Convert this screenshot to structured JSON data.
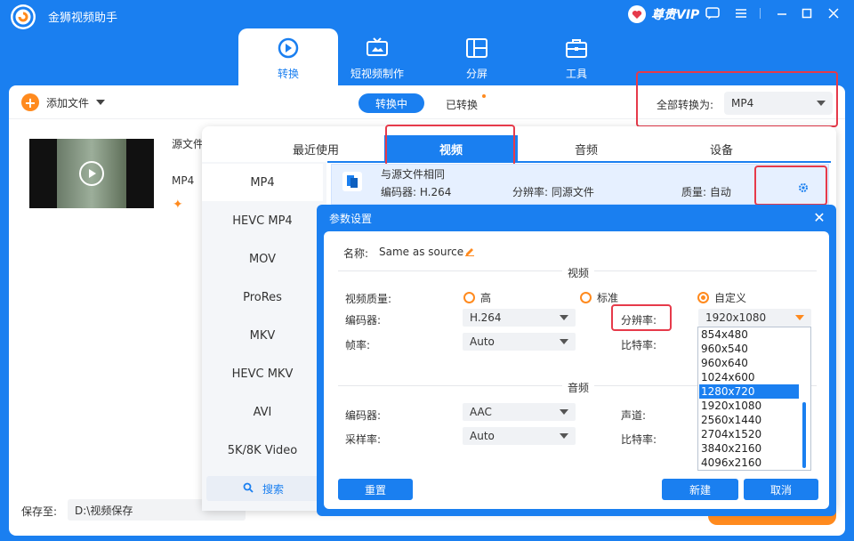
{
  "app": {
    "name": "金狮视频助手",
    "vip_label": "尊贵VIP"
  },
  "nav": {
    "tabs": [
      {
        "label": "转换",
        "icon": "convert-icon",
        "active": true
      },
      {
        "label": "短视频制作",
        "icon": "tv-icon",
        "active": false
      },
      {
        "label": "分屏",
        "icon": "split-screen-icon",
        "active": false
      },
      {
        "label": "工具",
        "icon": "toolbox-icon",
        "active": false
      }
    ]
  },
  "toolbar": {
    "add_file": "添加文件",
    "converting": "转换中",
    "converted": "已转换",
    "convert_all_label": "全部转换为:",
    "convert_all_value": "MP4"
  },
  "file_item": {
    "source_label": "源文件",
    "format": "MP4"
  },
  "bottom": {
    "save_to_label": "保存至:",
    "save_path": "D:\\视频保存"
  },
  "format_popup": {
    "tabs": [
      "最近使用",
      "视频",
      "音频",
      "设备"
    ],
    "active_tab": "视频",
    "formats": [
      "MP4",
      "HEVC MP4",
      "MOV",
      "ProRes",
      "MKV",
      "HEVC MKV",
      "AVI",
      "5K/8K Video"
    ],
    "active_format": "MP4",
    "search_label": "搜索",
    "preset": {
      "name": "与源文件相同",
      "encoder": "编码器: H.264",
      "resolution": "分辨率: 同源文件",
      "quality": "质量: 自动"
    }
  },
  "params_dialog": {
    "title": "参数设置",
    "name_label": "名称:",
    "name_value": "Same as source",
    "video_section": "视频",
    "quality_label": "视频质量:",
    "quality_options": [
      "高",
      "标准",
      "自定义"
    ],
    "quality_selected": "自定义",
    "encoder_label": "编码器:",
    "encoder_value": "H.264",
    "resolution_label": "分辨率:",
    "resolution_value": "1920x1080",
    "framerate_label": "帧率:",
    "framerate_value": "Auto",
    "bitrate_label": "比特率:",
    "audio_section": "音频",
    "audio_encoder_label": "编码器:",
    "audio_encoder_value": "AAC",
    "channel_label": "声道:",
    "samplerate_label": "采样率:",
    "samplerate_value": "Auto",
    "audio_bitrate_label": "比特率:",
    "reset_button": "重置",
    "new_button": "新建",
    "cancel_button": "取消",
    "resolution_options": [
      "854x480",
      "960x540",
      "960x640",
      "1024x600",
      "1280x720",
      "1920x1080",
      "2560x1440",
      "2704x1520",
      "3840x2160",
      "4096x2160"
    ],
    "resolution_highlighted": "1280x720"
  },
  "colors": {
    "primary": "#1a7ff0",
    "accent": "#ff8a1e",
    "highlight_box": "#e63a4a"
  }
}
